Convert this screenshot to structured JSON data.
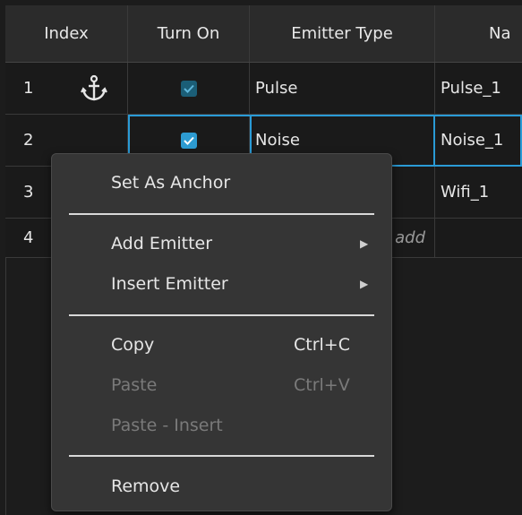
{
  "table": {
    "headers": {
      "index": "Index",
      "turn_on": "Turn On",
      "emitter_type": "Emitter Type",
      "name": "Na"
    },
    "rows": [
      {
        "index": "1",
        "emitter_type": "Pulse",
        "name": "Pulse_1",
        "checked": true,
        "anchor": true
      },
      {
        "index": "2",
        "emitter_type": "Noise",
        "name": "Noise_1",
        "checked": true,
        "selected": true
      },
      {
        "index": "3",
        "emitter_type": "",
        "name": "Wifi_1",
        "checked": false
      },
      {
        "index": "4",
        "emitter_type": "add",
        "name": "",
        "checked": false
      }
    ]
  },
  "context_menu": {
    "set_as_anchor": "Set As Anchor",
    "add_emitter": "Add Emitter",
    "insert_emitter": "Insert Emitter",
    "copy": "Copy",
    "copy_shortcut": "Ctrl+C",
    "paste": "Paste",
    "paste_shortcut": "Ctrl+V",
    "paste_insert": "Paste - Insert",
    "remove": "Remove",
    "submenu_arrow": "▶"
  },
  "icons": {
    "anchor": "anchor-icon",
    "checkbox": "checkmark-icon"
  },
  "colors": {
    "accent": "#2a9bd6",
    "background": "#1c1c1c",
    "menu_bg": "#353535"
  }
}
